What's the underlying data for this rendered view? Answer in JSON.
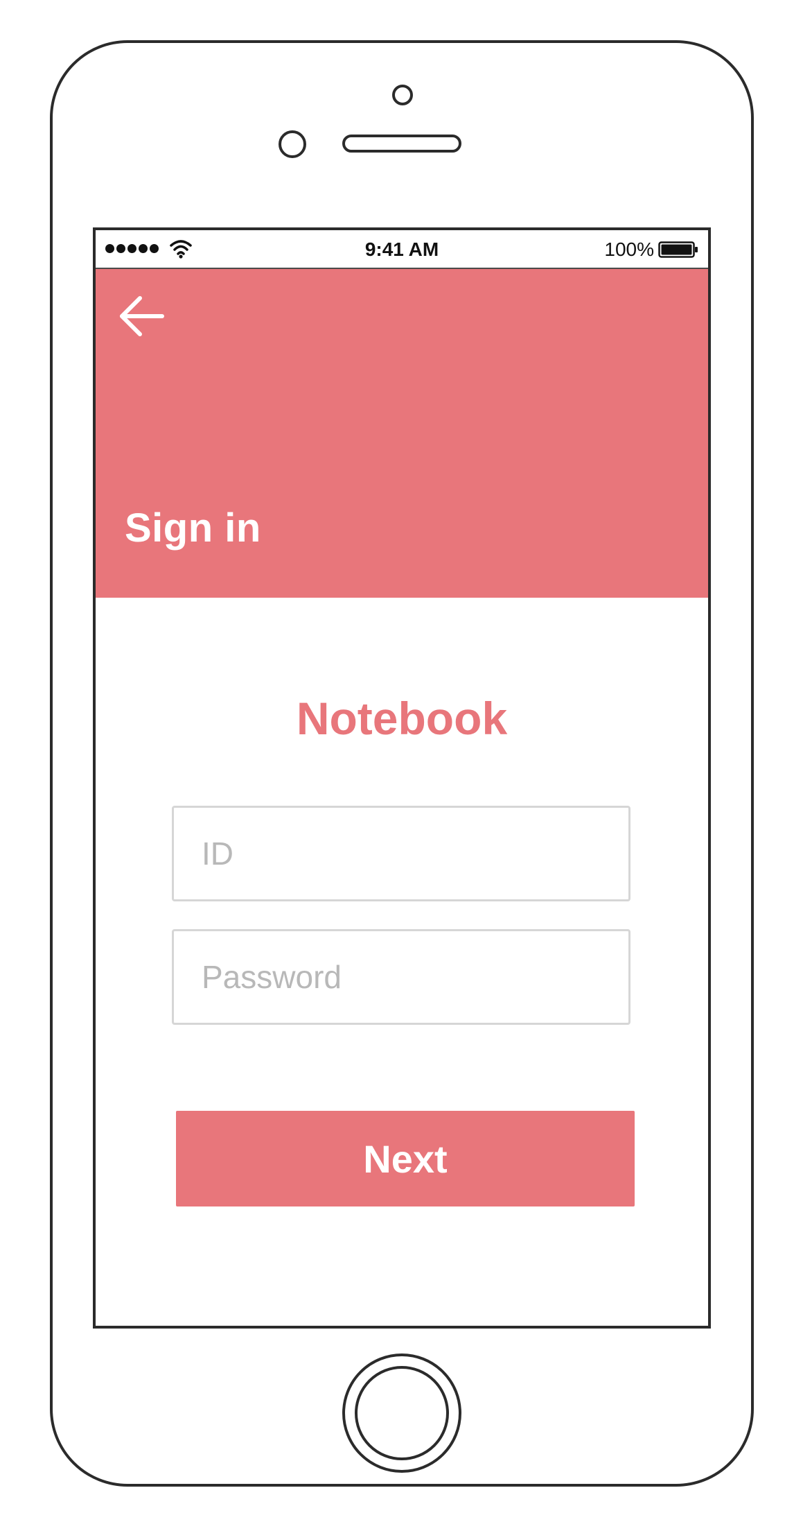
{
  "status_bar": {
    "time": "9:41 AM",
    "battery_percent": "100%",
    "signal_icon": "signal-dots-icon",
    "wifi_icon": "wifi-icon",
    "battery_icon": "battery-full-icon"
  },
  "header": {
    "back_icon": "arrow-left-icon",
    "title": "Sign in"
  },
  "main": {
    "brand_title": "Notebook",
    "id_field": {
      "value": "",
      "placeholder": "ID"
    },
    "password_field": {
      "value": "",
      "placeholder": "Password"
    },
    "next_label": "Next"
  },
  "colors": {
    "accent": "#e8767b",
    "placeholder": "#b8b8b8",
    "frame": "#2b2b2b",
    "field_border": "#d6d6d6"
  }
}
